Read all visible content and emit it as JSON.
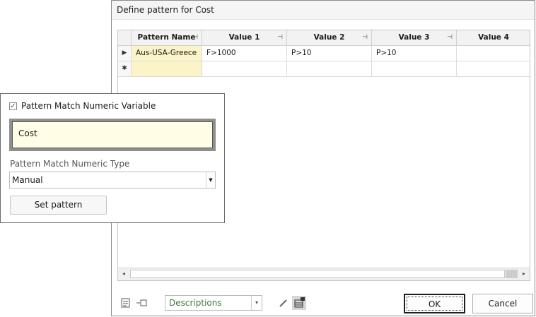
{
  "dialog": {
    "title": "Define pattern for Cost",
    "grid": {
      "columns": [
        "Pattern Name",
        "Value 1",
        "Value 2",
        "Value 3",
        "Value 4"
      ],
      "rows": [
        {
          "indicator": "▶",
          "cells": [
            "Aus-USA-Greece",
            "F>1000",
            "P>10",
            "P>10",
            ""
          ]
        },
        {
          "indicator": "✱",
          "cells": [
            "",
            "",
            "",
            "",
            ""
          ]
        }
      ],
      "pin_glyph": "⊣",
      "scroll_left": "◂",
      "scroll_right": "▸"
    },
    "toolbar": {
      "icon1": "notes-icon",
      "icon2": "insert-icon",
      "description_select": "Descriptions",
      "icon3": "pencil-icon",
      "icon4": "layout-icon",
      "dropdown_arrow": "▾"
    },
    "ok_label": "OK",
    "cancel_label": "Cancel"
  },
  "panel": {
    "checkbox_label": "Pattern Match Numeric Variable",
    "checkbox_checked": true,
    "variable_name": "Cost",
    "type_label": "Pattern Match Numeric Type",
    "type_value": "Manual",
    "set_pattern_label": "Set pattern"
  },
  "colors": {
    "selected_cell": "#fbf4c8",
    "description_text": "#3b7a3b"
  }
}
